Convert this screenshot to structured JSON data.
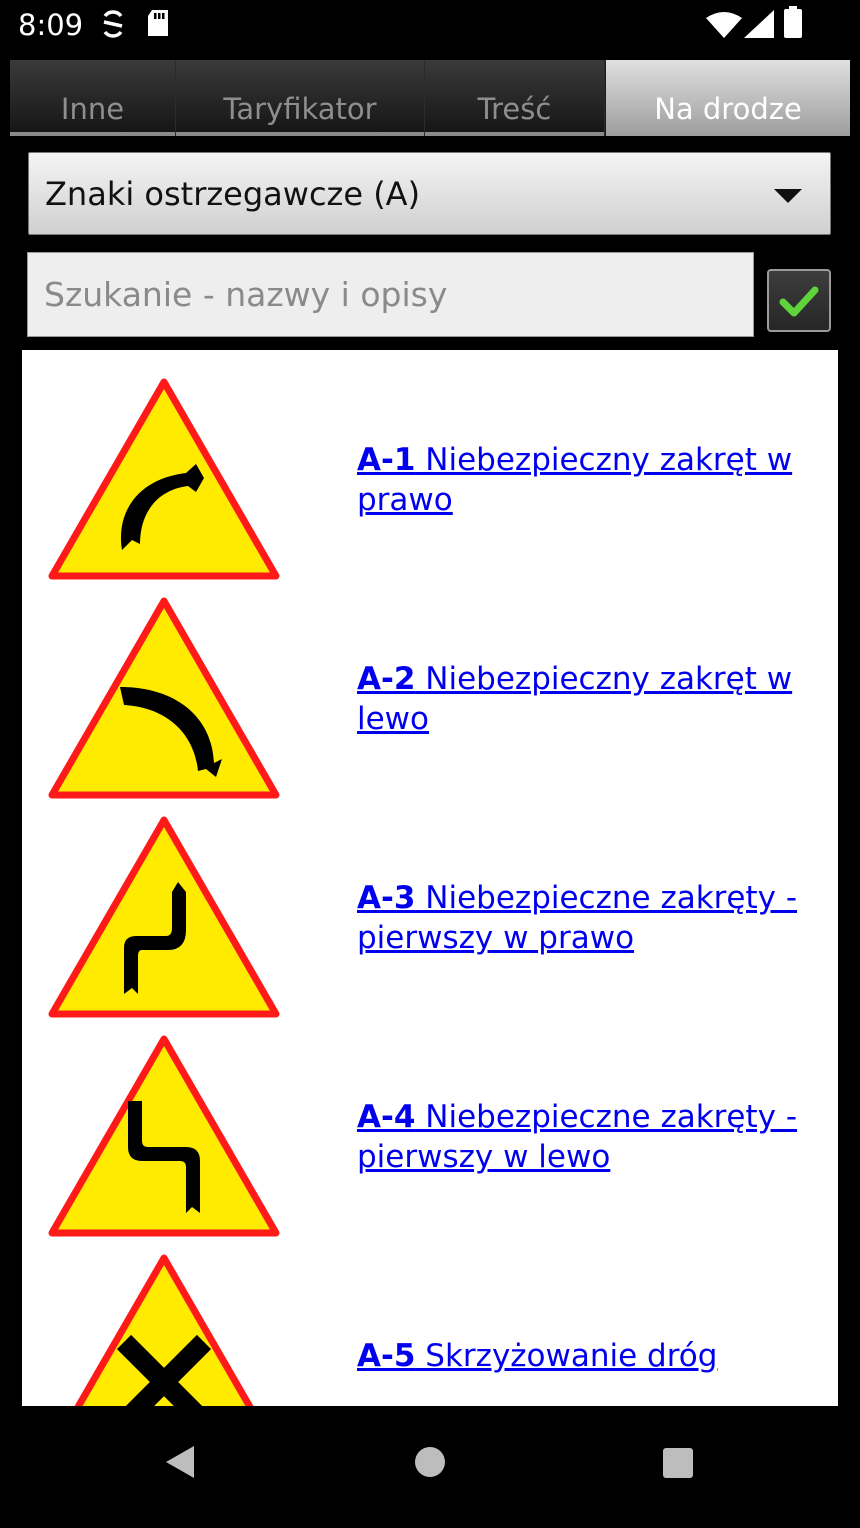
{
  "status_bar": {
    "time": "8:09",
    "icons": [
      "sync-icon",
      "sd-card-icon",
      "wifi-icon",
      "signal-icon",
      "battery-icon"
    ]
  },
  "tabs": [
    {
      "label": "Inne",
      "active": false
    },
    {
      "label": "Taryfikator",
      "active": false
    },
    {
      "label": "Treść",
      "active": false
    },
    {
      "label": "Na drodze",
      "active": true
    }
  ],
  "category_select": {
    "selected": "Znaki ostrzegawcze (A)"
  },
  "search": {
    "placeholder": "Szukanie - nazwy i opisy",
    "value": "",
    "descriptions_checkbox_checked": true
  },
  "signs": [
    {
      "code": "A-1",
      "name": " Niebezpieczny zakręt w prawo",
      "icon": "sign-a1-right-curve-icon"
    },
    {
      "code": "A-2",
      "name": " Niebezpieczny zakręt w lewo",
      "icon": "sign-a2-left-curve-icon"
    },
    {
      "code": "A-3",
      "name": " Niebezpieczne zakręty - pierwszy w prawo",
      "icon": "sign-a3-double-curve-right-icon"
    },
    {
      "code": "A-4",
      "name": " Niebezpieczne zakręty - pierwszy w lewo",
      "icon": "sign-a4-double-curve-left-icon"
    },
    {
      "code": "A-5",
      "name": " Skrzyżowanie dróg",
      "icon": "sign-a5-crossroads-icon"
    }
  ],
  "colors": {
    "sign_fill": "#ffeb00",
    "sign_border": "#ff1a1a",
    "link": "#0000ee",
    "check": "#5fd33a"
  },
  "nav_bar": {
    "icons": [
      "back-icon",
      "home-icon",
      "recents-icon"
    ]
  }
}
